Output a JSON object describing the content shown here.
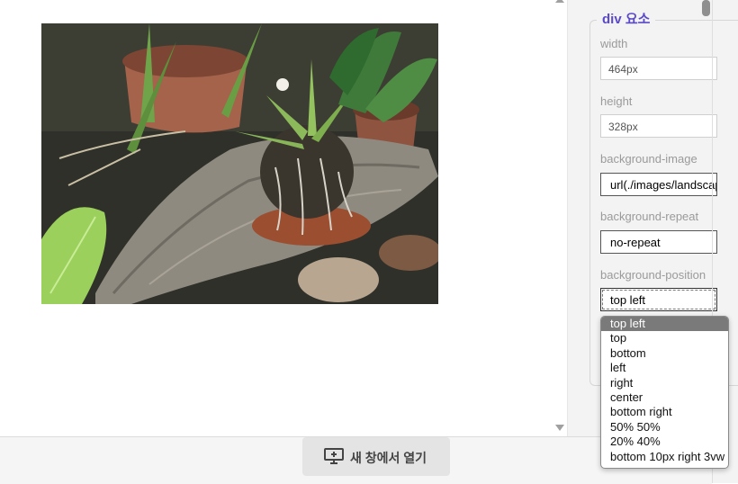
{
  "preview": {
    "image_alt": "Potted succulent plants on a weathered wooden board"
  },
  "panel": {
    "legend": "div 요소",
    "fields": [
      {
        "label": "width",
        "value": "464px"
      },
      {
        "label": "height",
        "value": "328px"
      },
      {
        "label": "background-image",
        "value": "url(./images/landscape.jpg)"
      },
      {
        "label": "background-repeat",
        "value": "no-repeat"
      },
      {
        "label": "background-position",
        "value": "top left"
      }
    ]
  },
  "dropdown": {
    "selected": "top left",
    "options": [
      "top left",
      "top",
      "bottom",
      "left",
      "right",
      "center",
      "bottom right",
      "50% 50%",
      "20% 40%",
      "bottom 10px right 3vw"
    ]
  },
  "bottom": {
    "open_new_window_label": "새 창에서 열기",
    "open_icon": "monitor-plus-icon"
  }
}
